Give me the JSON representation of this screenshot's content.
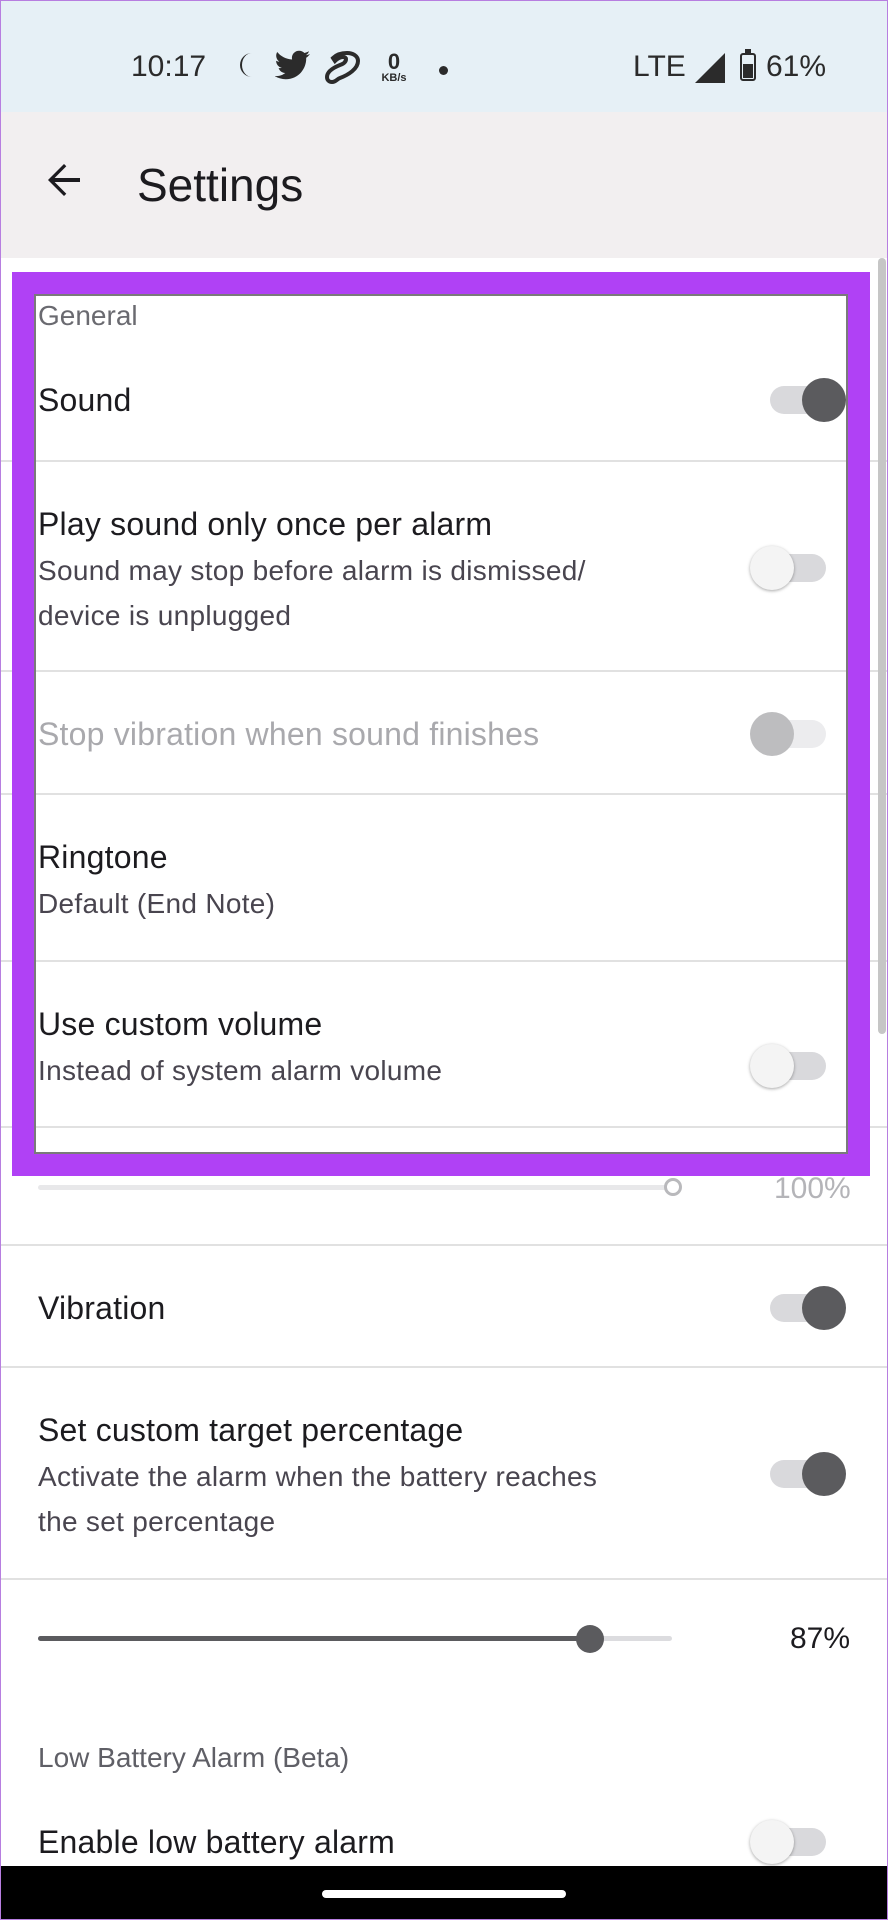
{
  "status_bar": {
    "time": "10:17",
    "net_speed_value": "0",
    "net_speed_unit": "KB/s",
    "network": "LTE",
    "battery": "61%",
    "icons": [
      "moon-icon",
      "twitter-icon",
      "airtel-icon",
      "net-speed-icon",
      "notification-dot-icon",
      "signal-icon",
      "battery-icon"
    ]
  },
  "app_bar": {
    "back_icon": "arrow-back-icon",
    "title": "Settings"
  },
  "general": {
    "header": "General",
    "sound": {
      "title": "Sound",
      "enabled": true
    },
    "play_once": {
      "title": "Play sound only once per alarm",
      "subtitle_line1": "Sound may stop before alarm is dismissed/",
      "subtitle_line2": "device is unplugged",
      "enabled": false
    },
    "stop_vibration": {
      "title": "Stop vibration when sound finishes",
      "enabled": false,
      "disabled": true
    },
    "ringtone": {
      "title": "Ringtone",
      "subtitle": "Default (End Note)"
    },
    "custom_volume": {
      "title": "Use custom volume",
      "subtitle": "Instead of system alarm volume",
      "enabled": false
    },
    "volume_slider": {
      "value_label": "100%",
      "fraction": 1.0
    },
    "vibration": {
      "title": "Vibration",
      "enabled": true
    },
    "target_percentage": {
      "title": "Set custom target percentage",
      "subtitle_line1": "Activate the alarm when the battery reaches",
      "subtitle_line2": "the set percentage",
      "enabled": true
    },
    "target_slider": {
      "value_label": "87%",
      "fraction": 0.87
    }
  },
  "low_battery": {
    "header": "Low Battery Alarm (Beta)",
    "enable": {
      "title": "Enable low battery alarm",
      "enabled": false
    }
  },
  "colors": {
    "highlight": "#b041f5",
    "switch_on": "#5b5b5e",
    "status_bar_bg": "#e6f0f6",
    "app_bar_bg": "#f2eff0"
  }
}
